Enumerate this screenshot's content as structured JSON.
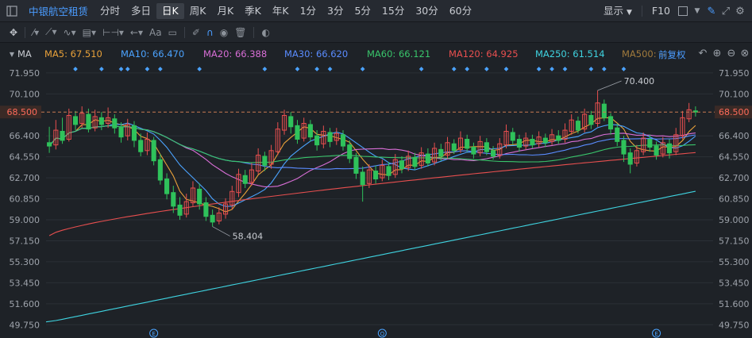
{
  "topbar": {
    "title": "中银航空租赁",
    "tabs": [
      "分时",
      "多日",
      "日K",
      "周K",
      "月K",
      "季K",
      "年K",
      "1分",
      "3分",
      "5分",
      "15分",
      "30分",
      "60分"
    ],
    "active_tab": "日K",
    "display_label": "显示",
    "f10_label": "F10"
  },
  "toolbar": {
    "text_tool_label": "Aa"
  },
  "ma_bar": {
    "ma_label": "MA",
    "adjust_label": "前复权",
    "items": [
      {
        "label": "MA5: 67.510",
        "color": "#e8a13a"
      },
      {
        "label": "MA10: 66.470",
        "color": "#4ba3ff"
      },
      {
        "label": "MA20: 66.388",
        "color": "#d86ed6"
      },
      {
        "label": "MA30: 66.620",
        "color": "#5a8cff"
      },
      {
        "label": "MA60: 66.121",
        "color": "#39c56b"
      },
      {
        "label": "MA120: 64.925",
        "color": "#e84f4f"
      },
      {
        "label": "MA250: 61.514",
        "color": "#3fd3e0"
      },
      {
        "label": "MA500: --",
        "color": "#a07a3c"
      }
    ]
  },
  "chart_data": {
    "type": "candlestick",
    "current_price": "68.500",
    "high_annotation": "70.400",
    "low_annotation": "58.404",
    "y_ticks": [
      "71.950",
      "70.100",
      "68.500",
      "66.400",
      "64.550",
      "62.700",
      "60.850",
      "59.000",
      "57.150",
      "55.300",
      "53.450",
      "51.600",
      "49.750"
    ],
    "ylim": [
      49.0,
      72.5
    ],
    "event_markers": [
      "E",
      "Q",
      "E"
    ],
    "candles": [
      [
        65.8,
        65.5,
        67.2,
        64.9
      ],
      [
        65.6,
        66.9,
        67.8,
        65.2
      ],
      [
        66.8,
        66.0,
        68.0,
        65.7
      ],
      [
        66.1,
        68.2,
        68.8,
        65.9
      ],
      [
        68.1,
        67.4,
        68.6,
        66.9
      ],
      [
        67.5,
        68.4,
        69.0,
        67.1
      ],
      [
        68.3,
        67.0,
        68.8,
        66.7
      ],
      [
        67.1,
        68.1,
        68.7,
        66.8
      ],
      [
        68.0,
        67.4,
        68.5,
        66.9
      ],
      [
        67.5,
        68.0,
        68.9,
        67.1
      ],
      [
        67.9,
        67.1,
        68.3,
        66.6
      ],
      [
        67.2,
        66.3,
        67.6,
        65.8
      ],
      [
        66.4,
        67.4,
        67.9,
        66.0
      ],
      [
        67.3,
        66.0,
        67.7,
        65.4
      ],
      [
        66.0,
        65.0,
        66.6,
        64.6
      ],
      [
        65.1,
        66.1,
        66.7,
        64.7
      ],
      [
        66.0,
        64.2,
        66.3,
        63.8
      ],
      [
        64.3,
        62.5,
        64.8,
        62.1
      ],
      [
        62.6,
        61.3,
        63.1,
        60.8
      ],
      [
        61.4,
        60.2,
        62.0,
        59.6
      ],
      [
        60.3,
        59.4,
        61.0,
        59.0
      ],
      [
        59.5,
        60.6,
        61.3,
        59.2
      ],
      [
        60.5,
        61.8,
        62.4,
        60.2
      ],
      [
        61.7,
        60.4,
        62.2,
        59.9
      ],
      [
        60.5,
        59.3,
        61.0,
        58.9
      ],
      [
        59.4,
        58.8,
        59.9,
        58.404
      ],
      [
        58.9,
        59.6,
        60.1,
        58.6
      ],
      [
        59.5,
        60.4,
        60.9,
        59.1
      ],
      [
        60.3,
        61.5,
        62.0,
        59.9
      ],
      [
        61.4,
        63.0,
        63.5,
        61.0
      ],
      [
        62.9,
        62.2,
        63.4,
        61.8
      ],
      [
        62.3,
        63.4,
        64.0,
        62.0
      ],
      [
        63.3,
        64.7,
        65.3,
        63.0
      ],
      [
        64.6,
        63.8,
        65.0,
        63.3
      ],
      [
        63.9,
        65.1,
        65.6,
        63.5
      ],
      [
        65.0,
        67.0,
        67.6,
        64.7
      ],
      [
        66.9,
        68.2,
        68.7,
        66.5
      ],
      [
        68.1,
        67.2,
        68.5,
        66.6
      ],
      [
        67.3,
        66.1,
        67.8,
        65.7
      ],
      [
        66.2,
        67.5,
        68.0,
        65.9
      ],
      [
        67.4,
        66.3,
        67.8,
        65.9
      ],
      [
        66.4,
        65.6,
        66.9,
        65.1
      ],
      [
        65.7,
        66.8,
        67.3,
        65.3
      ],
      [
        66.7,
        65.9,
        67.1,
        65.4
      ],
      [
        66.0,
        66.6,
        67.1,
        65.6
      ],
      [
        66.5,
        65.5,
        66.9,
        65.1
      ],
      [
        65.6,
        64.4,
        66.0,
        64.0
      ],
      [
        64.5,
        63.1,
        64.9,
        62.6
      ],
      [
        63.2,
        62.1,
        63.7,
        60.6
      ],
      [
        62.2,
        63.4,
        63.9,
        61.8
      ],
      [
        63.3,
        62.6,
        63.8,
        62.2
      ],
      [
        62.7,
        63.8,
        64.3,
        62.4
      ],
      [
        63.7,
        62.9,
        64.1,
        62.5
      ],
      [
        63.0,
        64.3,
        64.8,
        62.7
      ],
      [
        64.2,
        63.5,
        64.6,
        63.1
      ],
      [
        63.6,
        64.6,
        65.1,
        63.3
      ],
      [
        64.5,
        63.7,
        64.9,
        63.4
      ],
      [
        63.8,
        64.9,
        65.4,
        63.5
      ],
      [
        64.8,
        64.0,
        65.3,
        63.7
      ],
      [
        64.1,
        65.3,
        65.8,
        63.8
      ],
      [
        65.2,
        64.6,
        65.7,
        64.2
      ],
      [
        64.7,
        65.8,
        66.3,
        64.4
      ],
      [
        65.7,
        65.1,
        66.1,
        64.8
      ],
      [
        65.2,
        66.2,
        66.8,
        64.9
      ],
      [
        66.1,
        65.3,
        66.5,
        65.0
      ],
      [
        65.4,
        64.8,
        65.8,
        64.4
      ],
      [
        64.9,
        65.9,
        66.4,
        64.6
      ],
      [
        65.8,
        65.0,
        66.2,
        64.7
      ],
      [
        65.1,
        64.6,
        65.5,
        64.3
      ],
      [
        64.7,
        65.7,
        66.2,
        64.4
      ],
      [
        65.6,
        66.8,
        67.4,
        65.3
      ],
      [
        66.7,
        66.0,
        67.1,
        65.6
      ],
      [
        66.1,
        65.4,
        66.5,
        65.0
      ],
      [
        65.5,
        66.2,
        66.7,
        65.2
      ],
      [
        66.1,
        65.6,
        66.5,
        65.3
      ],
      [
        65.7,
        66.3,
        66.8,
        65.4
      ],
      [
        66.2,
        65.8,
        66.6,
        65.4
      ],
      [
        65.9,
        66.5,
        67.0,
        65.6
      ],
      [
        66.4,
        66.0,
        66.9,
        65.7
      ],
      [
        66.1,
        66.9,
        67.5,
        65.8
      ],
      [
        66.8,
        67.8,
        68.3,
        66.5
      ],
      [
        67.7,
        66.9,
        68.1,
        66.6
      ],
      [
        67.0,
        68.3,
        68.8,
        66.7
      ],
      [
        68.2,
        67.4,
        68.6,
        67.0
      ],
      [
        67.5,
        69.3,
        70.4,
        67.2
      ],
      [
        69.2,
        68.0,
        69.6,
        67.7
      ],
      [
        68.1,
        67.0,
        68.4,
        66.5
      ],
      [
        67.1,
        65.9,
        67.5,
        65.5
      ],
      [
        66.0,
        64.8,
        66.4,
        64.1
      ],
      [
        64.9,
        63.9,
        65.3,
        63.1
      ],
      [
        64.0,
        65.1,
        65.6,
        63.7
      ],
      [
        65.0,
        66.2,
        66.7,
        64.7
      ],
      [
        66.1,
        65.4,
        66.5,
        65.0
      ],
      [
        65.5,
        64.7,
        65.9,
        64.3
      ],
      [
        64.8,
        65.8,
        66.3,
        64.5
      ],
      [
        65.7,
        64.9,
        66.1,
        64.4
      ],
      [
        65.0,
        66.5,
        67.1,
        64.7
      ],
      [
        66.4,
        68.0,
        68.6,
        66.1
      ],
      [
        67.9,
        68.7,
        69.3,
        67.6
      ],
      [
        68.6,
        68.5,
        69.0,
        68.1
      ]
    ],
    "ma_series": [
      {
        "name": "MA5",
        "color": "#e8a13a"
      },
      {
        "name": "MA10",
        "color": "#4ba3ff"
      },
      {
        "name": "MA20",
        "color": "#d86ed6"
      },
      {
        "name": "MA30",
        "color": "#5a8cff"
      },
      {
        "name": "MA60",
        "color": "#39c56b"
      },
      {
        "name": "MA120",
        "color": "#e84f4f"
      },
      {
        "name": "MA250",
        "color": "#3fd3e0"
      }
    ],
    "ma120_range": [
      57.6,
      64.925
    ],
    "ma250_range": [
      50.0,
      61.514
    ],
    "up_color": "#e84f4f",
    "down_color": "#2fc25b",
    "grid": true
  }
}
